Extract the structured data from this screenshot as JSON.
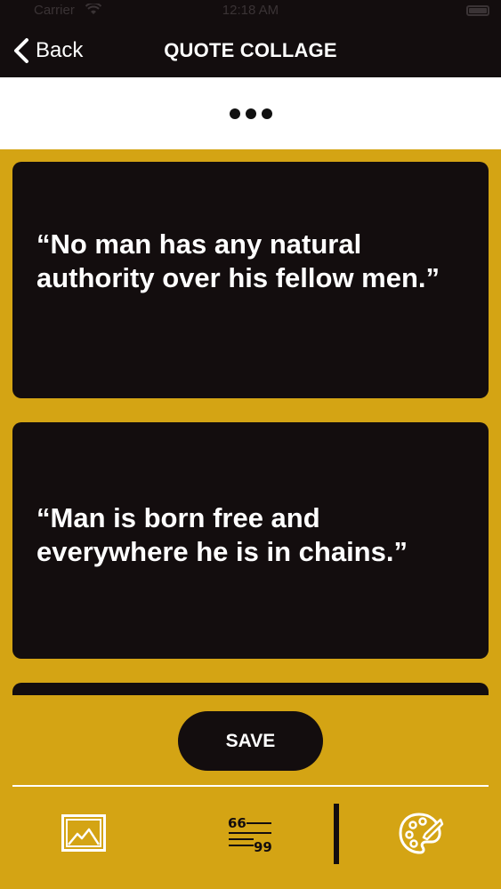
{
  "status_bar": {
    "carrier": "Carrier",
    "time": "12:18 AM"
  },
  "nav": {
    "back_label": "Back",
    "title": "QUOTE COLLAGE"
  },
  "collage": {
    "quotes": [
      "“No man has any natural authority over his fellow men.”",
      "“Man is born free and everywhere he is in chains.”"
    ]
  },
  "bottom": {
    "save_label": "SAVE",
    "tools": [
      "picture-icon",
      "quote-text-icon",
      "palette-icon"
    ]
  },
  "colors": {
    "accent": "#d4a414",
    "dark": "#130d0e",
    "light": "#ffffff"
  }
}
